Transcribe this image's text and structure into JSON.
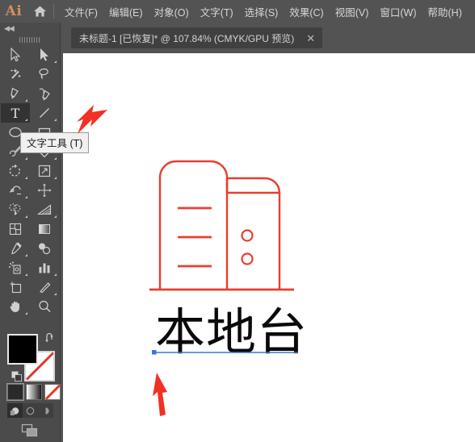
{
  "app": {
    "logo_text": "Ai",
    "home_icon": "home-icon"
  },
  "menubar": {
    "items": [
      {
        "label": "文件(F)",
        "name": "menu-file"
      },
      {
        "label": "编辑(E)",
        "name": "menu-edit"
      },
      {
        "label": "对象(O)",
        "name": "menu-object"
      },
      {
        "label": "文字(T)",
        "name": "menu-type"
      },
      {
        "label": "选择(S)",
        "name": "menu-select"
      },
      {
        "label": "效果(C)",
        "name": "menu-effect"
      },
      {
        "label": "视图(V)",
        "name": "menu-view"
      },
      {
        "label": "窗口(W)",
        "name": "menu-window"
      },
      {
        "label": "帮助(H)",
        "name": "menu-help"
      }
    ]
  },
  "tabbar": {
    "title": "未标题-1 [已恢复]* @ 107.84% (CMYK/GPU 预览)",
    "close_label": "✕",
    "document_name": "未标题-1",
    "recovered_label": "[已恢复]",
    "modified_marker": "*",
    "zoom_level": "107.84%",
    "color_mode": "CMYK/GPU 预览"
  },
  "toolpanel": {
    "collapse_label": "◀◀",
    "tools": [
      {
        "name": "selection-tool",
        "label": "选择工具",
        "has_flyout": false,
        "active": false
      },
      {
        "name": "direct-selection-tool",
        "label": "直接选择工具",
        "has_flyout": true,
        "active": false
      },
      {
        "name": "magic-wand-tool",
        "label": "魔棒工具",
        "has_flyout": false,
        "active": false
      },
      {
        "name": "lasso-tool",
        "label": "套索工具",
        "has_flyout": false,
        "active": false
      },
      {
        "name": "pen-tool",
        "label": "钢笔工具",
        "has_flyout": true,
        "active": false
      },
      {
        "name": "curvature-tool",
        "label": "曲率工具",
        "has_flyout": false,
        "active": false
      },
      {
        "name": "type-tool",
        "label": "文字工具",
        "has_flyout": true,
        "active": true
      },
      {
        "name": "line-segment-tool",
        "label": "直线段工具",
        "has_flyout": true,
        "active": false
      },
      {
        "name": "ellipse-tool",
        "label": "椭圆工具",
        "has_flyout": true,
        "active": false
      },
      {
        "name": "rectangle-tool",
        "label": "矩形工具",
        "has_flyout": true,
        "active": false
      },
      {
        "name": "paintbrush-tool",
        "label": "画笔工具",
        "has_flyout": true,
        "active": false
      },
      {
        "name": "eraser-tool",
        "label": "橡皮擦工具",
        "has_flyout": true,
        "active": false
      },
      {
        "name": "rotate-tool",
        "label": "旋转工具",
        "has_flyout": true,
        "active": false
      },
      {
        "name": "scale-tool",
        "label": "比例缩放工具",
        "has_flyout": true,
        "active": false
      },
      {
        "name": "width-tool",
        "label": "宽度工具",
        "has_flyout": true,
        "active": false
      },
      {
        "name": "free-transform-tool",
        "label": "自由变换工具",
        "has_flyout": false,
        "active": false
      },
      {
        "name": "shape-builder-tool",
        "label": "形状生成器工具",
        "has_flyout": true,
        "active": false
      },
      {
        "name": "perspective-grid-tool",
        "label": "透视网格工具",
        "has_flyout": true,
        "active": false
      },
      {
        "name": "mesh-tool",
        "label": "网格工具",
        "has_flyout": false,
        "active": false
      },
      {
        "name": "gradient-tool",
        "label": "渐变工具",
        "has_flyout": false,
        "active": false
      },
      {
        "name": "eyedropper-tool",
        "label": "吸管工具",
        "has_flyout": true,
        "active": false
      },
      {
        "name": "blend-tool",
        "label": "混合工具",
        "has_flyout": false,
        "active": false
      },
      {
        "name": "symbol-sprayer-tool",
        "label": "符号喷枪工具",
        "has_flyout": true,
        "active": false
      },
      {
        "name": "column-graph-tool",
        "label": "柱形图工具",
        "has_flyout": true,
        "active": false
      },
      {
        "name": "artboard-tool",
        "label": "画板工具",
        "has_flyout": false,
        "active": false
      },
      {
        "name": "slice-tool",
        "label": "切片工具",
        "has_flyout": true,
        "active": false
      },
      {
        "name": "hand-tool",
        "label": "抓手工具",
        "has_flyout": true,
        "active": false
      },
      {
        "name": "zoom-tool",
        "label": "缩放工具",
        "has_flyout": false,
        "active": false
      }
    ],
    "tooltip": {
      "text": "文字工具 (T)",
      "for_tool": "type-tool"
    },
    "colors": {
      "fill": "#000000",
      "stroke": "none",
      "fill_label": "填色",
      "stroke_label": "描边",
      "modes": [
        {
          "name": "color-mode-flat",
          "label": "颜色",
          "selected": true
        },
        {
          "name": "color-mode-gradient",
          "label": "渐变",
          "selected": false
        },
        {
          "name": "color-mode-none",
          "label": "无",
          "selected": false
        }
      ],
      "draw_modes": [
        {
          "name": "draw-normal",
          "label": "正常绘图",
          "selected": true
        },
        {
          "name": "draw-behind",
          "label": "背面绘图",
          "selected": false
        },
        {
          "name": "draw-inside",
          "label": "内部绘图",
          "selected": false
        }
      ],
      "screen_mode": {
        "name": "change-screen-mode",
        "label": "更改屏幕模式"
      }
    }
  },
  "canvas": {
    "background": "#ffffff",
    "artwork": {
      "name": "server-tower-illustration",
      "stroke_color": "#ea3d2f",
      "stroke_width": 2,
      "description": "红色线稿机箱/服务器图标"
    },
    "text_object": {
      "content": "本地台",
      "color": "#0a0a0a",
      "baseline_color": "#3b76d8",
      "anchor_color": "#3b76d8",
      "selected": true
    },
    "annotations": [
      {
        "name": "annotation-arrow-to-tooltip",
        "color": "#f03123",
        "direction": "down-left"
      },
      {
        "name": "annotation-arrow-to-text",
        "color": "#f03123",
        "direction": "up-right"
      }
    ]
  }
}
